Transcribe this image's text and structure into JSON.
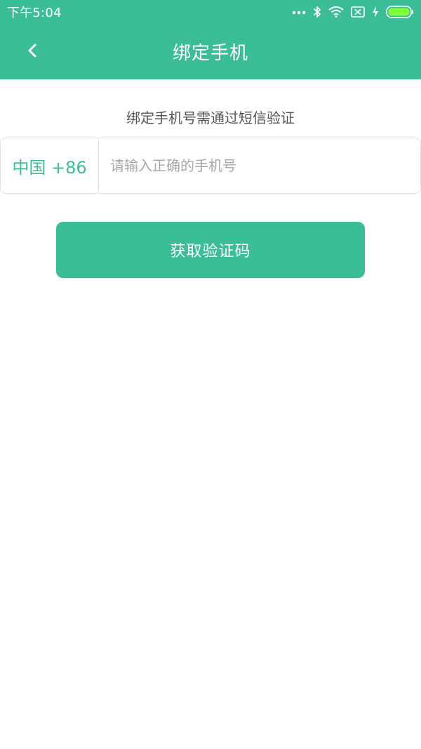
{
  "status_bar": {
    "time": "下午5:04",
    "icons": [
      "more-dots-icon",
      "bluetooth-icon",
      "wifi-icon",
      "sim-disabled-icon",
      "charging-icon",
      "battery-icon"
    ]
  },
  "nav": {
    "title": "绑定手机",
    "back_icon": "chevron-left-icon"
  },
  "content": {
    "hint": "绑定手机号需通过短信验证",
    "country_code": "中国 +86",
    "phone_placeholder": "请输入正确的手机号",
    "phone_value": "",
    "get_code_label": "获取验证码"
  },
  "colors": {
    "brand": "#3bbd98",
    "text_secondary": "#555555",
    "placeholder": "#a8a8a8",
    "border": "#e3e3e3"
  }
}
